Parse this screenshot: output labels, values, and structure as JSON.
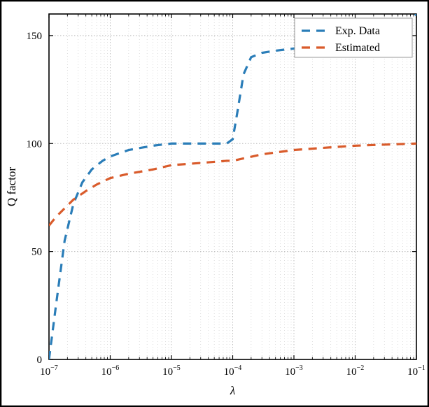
{
  "chart_data": {
    "type": "line",
    "xlabel": "λ",
    "ylabel": "Q factor",
    "xscale": "log",
    "xlim": [
      1e-07,
      0.1
    ],
    "ylim": [
      0,
      160
    ],
    "x_ticks_major": [
      1e-07,
      1e-06,
      1e-05,
      0.0001,
      0.001,
      0.01,
      0.1
    ],
    "x_tick_labels": [
      "10^{-7}",
      "10^{-6}",
      "10^{-5}",
      "10^{-4}",
      "10^{-3}",
      "10^{-2}",
      "10^{-1}"
    ],
    "y_ticks": [
      0,
      50,
      100,
      150
    ],
    "legend": [
      "Exp. Data",
      "Estimated"
    ],
    "legend_position": "upper right",
    "colors": {
      "exp": "#2a7db8",
      "est": "#d95b2b"
    },
    "series": [
      {
        "name": "Exp. Data",
        "color": "#2a7db8",
        "x": [
          1e-07,
          1.3e-07,
          1.8e-07,
          2.5e-07,
          3.5e-07,
          5e-07,
          7.5e-07,
          1e-06,
          2e-06,
          5e-06,
          1e-05,
          3e-05,
          8e-05,
          0.0001,
          0.00012,
          0.00015,
          0.0002,
          0.0003,
          0.0005,
          0.001,
          0.003,
          0.01,
          0.03,
          0.07,
          0.1
        ],
        "y": [
          0,
          25,
          55,
          72,
          82,
          88,
          92,
          94,
          97,
          99,
          100,
          100,
          100,
          102,
          115,
          132,
          140,
          142,
          143,
          144,
          145,
          147,
          150,
          155,
          160
        ]
      },
      {
        "name": "Estimated",
        "color": "#d95b2b",
        "x": [
          1e-07,
          1.3e-07,
          1.8e-07,
          2.5e-07,
          4e-07,
          6e-07,
          1e-06,
          2e-06,
          5e-06,
          1e-05,
          3e-05,
          8e-05,
          0.0001,
          0.0003,
          0.001,
          0.003,
          0.01,
          0.03,
          0.1
        ],
        "y": [
          62,
          66,
          70,
          74,
          78,
          81,
          84,
          86,
          88,
          90,
          91,
          92,
          92,
          95,
          97,
          98,
          99,
          99.5,
          100
        ]
      }
    ]
  }
}
